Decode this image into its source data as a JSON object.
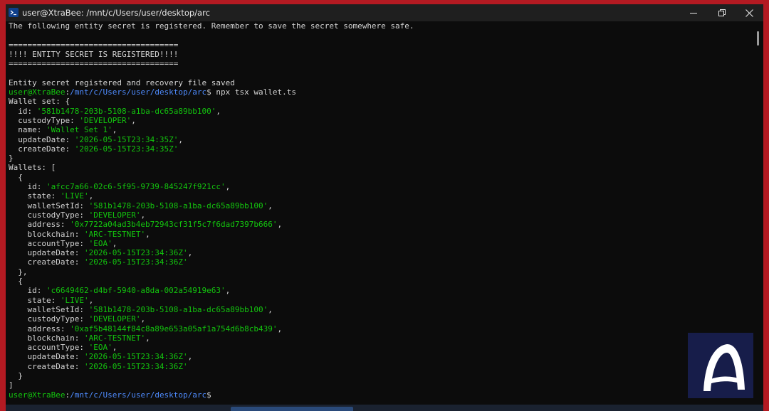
{
  "window": {
    "title": "user@XtraBee: /mnt/c/Users/user/desktop/arc",
    "icon": "terminal-icon",
    "controls": [
      "minimize-icon",
      "maximize-icon",
      "close-icon"
    ]
  },
  "colors": {
    "background": "#0c0c0c",
    "text": "#d4d4d4",
    "prompt_user": "#13c50e",
    "prompt_path": "#4f8cff",
    "string": "#13c50e",
    "frame": "#b31a22"
  },
  "terminal": {
    "lines": [
      [
        {
          "t": "The following entity secret is registered. Remember to save the secret somewhere safe.",
          "c": "w"
        }
      ],
      [],
      [
        {
          "t": "====================================",
          "c": "w"
        }
      ],
      [
        {
          "t": "!!!! ENTITY SECRET IS REGISTERED!!!!",
          "c": "w"
        }
      ],
      [
        {
          "t": "====================================",
          "c": "w"
        }
      ],
      [],
      [
        {
          "t": "Entity secret registered and recovery file saved",
          "c": "w"
        }
      ],
      [
        {
          "t": "user@XtraBee",
          "c": "g"
        },
        {
          "t": ":",
          "c": "w"
        },
        {
          "t": "/mnt/c/Users/user/desktop/arc",
          "c": "b"
        },
        {
          "t": "$ npx tsx wallet.ts",
          "c": "w"
        }
      ],
      [
        {
          "t": "Wallet set: {",
          "c": "w"
        }
      ],
      [
        {
          "t": "  id: ",
          "c": "w"
        },
        {
          "t": "'581b1478-203b-5108-a1ba-dc65a89bb100'",
          "c": "g"
        },
        {
          "t": ",",
          "c": "w"
        }
      ],
      [
        {
          "t": "  custodyType: ",
          "c": "w"
        },
        {
          "t": "'DEVELOPER'",
          "c": "g"
        },
        {
          "t": ",",
          "c": "w"
        }
      ],
      [
        {
          "t": "  name: ",
          "c": "w"
        },
        {
          "t": "'Wallet Set 1'",
          "c": "g"
        },
        {
          "t": ",",
          "c": "w"
        }
      ],
      [
        {
          "t": "  updateDate: ",
          "c": "w"
        },
        {
          "t": "'2026-05-15T23:34:35Z'",
          "c": "g"
        },
        {
          "t": ",",
          "c": "w"
        }
      ],
      [
        {
          "t": "  createDate: ",
          "c": "w"
        },
        {
          "t": "'2026-05-15T23:34:35Z'",
          "c": "g"
        }
      ],
      [
        {
          "t": "}",
          "c": "w"
        }
      ],
      [
        {
          "t": "Wallets: [",
          "c": "w"
        }
      ],
      [
        {
          "t": "  {",
          "c": "w"
        }
      ],
      [
        {
          "t": "    id: ",
          "c": "w"
        },
        {
          "t": "'afcc7a66-02c6-5f95-9739-845247f921cc'",
          "c": "g"
        },
        {
          "t": ",",
          "c": "w"
        }
      ],
      [
        {
          "t": "    state: ",
          "c": "w"
        },
        {
          "t": "'LIVE'",
          "c": "g"
        },
        {
          "t": ",",
          "c": "w"
        }
      ],
      [
        {
          "t": "    walletSetId: ",
          "c": "w"
        },
        {
          "t": "'581b1478-203b-5108-a1ba-dc65a89bb100'",
          "c": "g"
        },
        {
          "t": ",",
          "c": "w"
        }
      ],
      [
        {
          "t": "    custodyType: ",
          "c": "w"
        },
        {
          "t": "'DEVELOPER'",
          "c": "g"
        },
        {
          "t": ",",
          "c": "w"
        }
      ],
      [
        {
          "t": "    address: ",
          "c": "w"
        },
        {
          "t": "'0x7722a04ad3b4eb72943cf31f5c7f6dad7397b666'",
          "c": "g"
        },
        {
          "t": ",",
          "c": "w"
        }
      ],
      [
        {
          "t": "    blockchain: ",
          "c": "w"
        },
        {
          "t": "'ARC-TESTNET'",
          "c": "g"
        },
        {
          "t": ",",
          "c": "w"
        }
      ],
      [
        {
          "t": "    accountType: ",
          "c": "w"
        },
        {
          "t": "'EOA'",
          "c": "g"
        },
        {
          "t": ",",
          "c": "w"
        }
      ],
      [
        {
          "t": "    updateDate: ",
          "c": "w"
        },
        {
          "t": "'2026-05-15T23:34:36Z'",
          "c": "g"
        },
        {
          "t": ",",
          "c": "w"
        }
      ],
      [
        {
          "t": "    createDate: ",
          "c": "w"
        },
        {
          "t": "'2026-05-15T23:34:36Z'",
          "c": "g"
        }
      ],
      [
        {
          "t": "  },",
          "c": "w"
        }
      ],
      [
        {
          "t": "  {",
          "c": "w"
        }
      ],
      [
        {
          "t": "    id: ",
          "c": "w"
        },
        {
          "t": "'c6649462-d4bf-5940-a8da-002a54919e63'",
          "c": "g"
        },
        {
          "t": ",",
          "c": "w"
        }
      ],
      [
        {
          "t": "    state: ",
          "c": "w"
        },
        {
          "t": "'LIVE'",
          "c": "g"
        },
        {
          "t": ",",
          "c": "w"
        }
      ],
      [
        {
          "t": "    walletSetId: ",
          "c": "w"
        },
        {
          "t": "'581b1478-203b-5108-a1ba-dc65a89bb100'",
          "c": "g"
        },
        {
          "t": ",",
          "c": "w"
        }
      ],
      [
        {
          "t": "    custodyType: ",
          "c": "w"
        },
        {
          "t": "'DEVELOPER'",
          "c": "g"
        },
        {
          "t": ",",
          "c": "w"
        }
      ],
      [
        {
          "t": "    address: ",
          "c": "w"
        },
        {
          "t": "'0xaf5b48144f84c8a89e653a05af1a754d6b8cb439'",
          "c": "g"
        },
        {
          "t": ",",
          "c": "w"
        }
      ],
      [
        {
          "t": "    blockchain: ",
          "c": "w"
        },
        {
          "t": "'ARC-TESTNET'",
          "c": "g"
        },
        {
          "t": ",",
          "c": "w"
        }
      ],
      [
        {
          "t": "    accountType: ",
          "c": "w"
        },
        {
          "t": "'EOA'",
          "c": "g"
        },
        {
          "t": ",",
          "c": "w"
        }
      ],
      [
        {
          "t": "    updateDate: ",
          "c": "w"
        },
        {
          "t": "'2026-05-15T23:34:36Z'",
          "c": "g"
        },
        {
          "t": ",",
          "c": "w"
        }
      ],
      [
        {
          "t": "    createDate: ",
          "c": "w"
        },
        {
          "t": "'2026-05-15T23:34:36Z'",
          "c": "g"
        }
      ],
      [
        {
          "t": "  }",
          "c": "w"
        }
      ],
      [
        {
          "t": "]",
          "c": "w"
        }
      ],
      [
        {
          "t": "user@XtraBee",
          "c": "g"
        },
        {
          "t": ":",
          "c": "w"
        },
        {
          "t": "/mnt/c/Users/user/desktop/arc",
          "c": "b"
        },
        {
          "t": "$",
          "c": "w"
        }
      ]
    ]
  },
  "watermark": {
    "icon": "arc-logo-icon"
  }
}
